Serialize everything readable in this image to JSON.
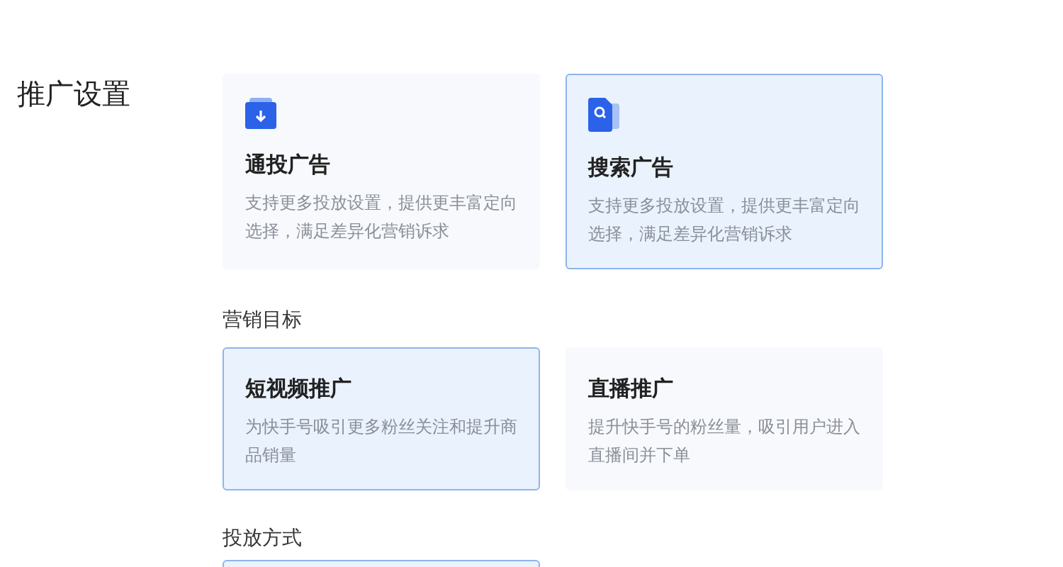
{
  "title": "推广设置",
  "ad_types": [
    {
      "kind": "folder",
      "title": "通投广告",
      "description": "支持更多投放设置，提供更丰富定向选择，满足差异化营销诉求",
      "selected": false
    },
    {
      "kind": "search",
      "title": "搜索广告",
      "description": "支持更多投放设置，提供更丰富定向选择，满足差异化营销诉求",
      "selected": true
    }
  ],
  "sections": [
    {
      "label": "营销目标",
      "cards": [
        {
          "title": "短视频推广",
          "description": "为快手号吸引更多粉丝关注和提升商品销量",
          "selected": true
        },
        {
          "title": "直播推广",
          "description": "提升快手号的粉丝量，吸引用户进入直播间并下单",
          "selected": false
        }
      ]
    },
    {
      "label": "投放方式",
      "cards": [
        {
          "selected": true
        }
      ]
    }
  ]
}
